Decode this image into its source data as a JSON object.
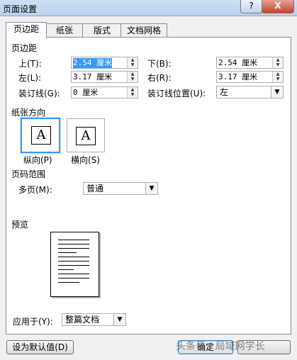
{
  "window": {
    "title": "页面设置",
    "help": "?",
    "close": "X"
  },
  "tabs": [
    {
      "label": "页边距"
    },
    {
      "label": "纸张"
    },
    {
      "label": "版式"
    },
    {
      "label": "文档网格"
    }
  ],
  "margins": {
    "section": "页边距",
    "top": {
      "label": "上(T):",
      "value": "2.54 厘米"
    },
    "bottom": {
      "label": "下(B):",
      "value": "2.54 厘米"
    },
    "left": {
      "label": "左(L):",
      "value": "3.17 厘米"
    },
    "right": {
      "label": "右(R):",
      "value": "3.17 厘米"
    },
    "gutter": {
      "label": "装订线(G):",
      "value": "0 厘米"
    },
    "gutter_pos": {
      "label": "装订线位置(U):",
      "value": "左"
    }
  },
  "orientation": {
    "section": "纸张方向",
    "portrait": {
      "label": "纵向(P)",
      "glyph": "A"
    },
    "landscape": {
      "label": "横向(S)",
      "glyph": "A"
    }
  },
  "pages": {
    "section": "页码范围",
    "multi_label": "多页(M):",
    "multi_value": "普通"
  },
  "preview": {
    "section": "预览"
  },
  "apply": {
    "label": "应用于(Y):",
    "value": "整篇文档"
  },
  "buttons": {
    "set_default": "设为默认值(D)",
    "ok": "确定"
  },
  "watermark": "头条号 / 局域网学长"
}
